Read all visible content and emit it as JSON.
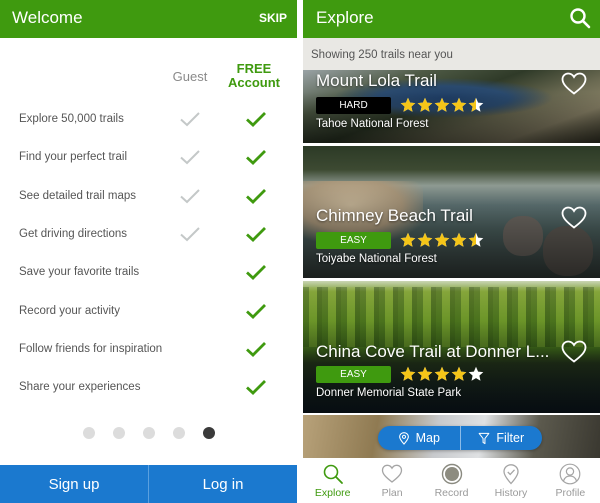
{
  "welcome": {
    "title": "Welcome",
    "skip_label": "SKIP",
    "columns": {
      "guest": "Guest",
      "free_line1": "FREE",
      "free_line2": "Account"
    },
    "features": [
      {
        "label": "Explore 50,000 trails",
        "guest": true,
        "free": true
      },
      {
        "label": "Find your perfect trail",
        "guest": true,
        "free": true
      },
      {
        "label": "See detailed trail maps",
        "guest": true,
        "free": true
      },
      {
        "label": "Get driving directions",
        "guest": true,
        "free": true
      },
      {
        "label": "Save your favorite trails",
        "guest": false,
        "free": true
      },
      {
        "label": "Record your activity",
        "guest": false,
        "free": true
      },
      {
        "label": "Follow friends for inspiration",
        "guest": false,
        "free": true
      },
      {
        "label": "Share your experiences",
        "guest": false,
        "free": true
      }
    ],
    "pager": {
      "total": 5,
      "current": 5
    },
    "signup_label": "Sign up",
    "login_label": "Log in"
  },
  "explore": {
    "title": "Explore",
    "showing_text": "Showing 250 trails near you",
    "trails": [
      {
        "name": "Mount Lola Trail",
        "difficulty": "HARD",
        "rating": 4.5,
        "location": "Tahoe National Forest",
        "favorited": false
      },
      {
        "name": "Chimney Beach Trail",
        "difficulty": "EASY",
        "rating": 4.5,
        "location": "Toiyabe National Forest",
        "favorited": false
      },
      {
        "name": "China Cove Trail at Donner L...",
        "difficulty": "EASY",
        "rating": 4,
        "location": "Donner Memorial State Park",
        "favorited": false
      }
    ],
    "map_label": "Map",
    "filter_label": "Filter",
    "tabs": [
      {
        "label": "Explore",
        "icon": "search-icon",
        "active": true
      },
      {
        "label": "Plan",
        "icon": "heart-icon",
        "active": false
      },
      {
        "label": "Record",
        "icon": "record-icon",
        "active": false
      },
      {
        "label": "History",
        "icon": "history-pin-icon",
        "active": false
      },
      {
        "label": "Profile",
        "icon": "profile-icon",
        "active": false
      }
    ]
  },
  "colors": {
    "brand_green": "#3f9a0f",
    "action_blue": "#1b79cf",
    "guest_check": "#c4c8c8",
    "star_yellow": "#f5c518",
    "tab_inactive": "#9a9a9a"
  }
}
